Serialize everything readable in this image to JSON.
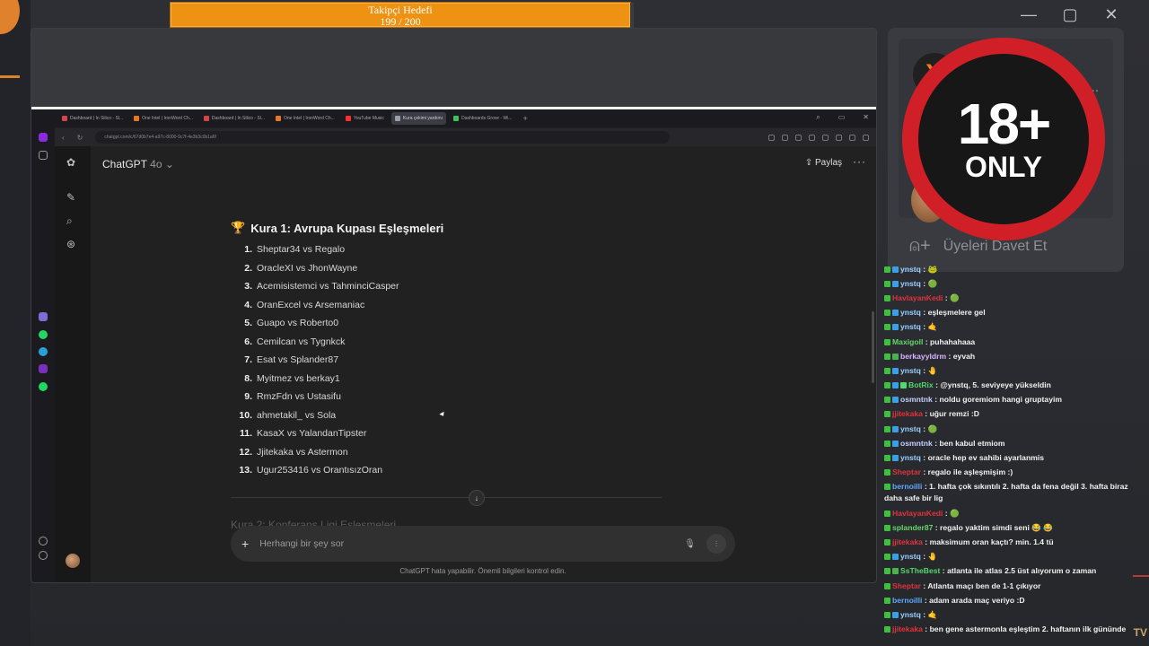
{
  "overlay": {
    "goal_title": "Takipçi Hedefi",
    "goal_progress": "199 / 200",
    "goal_fraction": 0.995,
    "window_controls": [
      "minimize-icon",
      "maximize-icon",
      "close-icon"
    ]
  },
  "browser": {
    "tabs": [
      {
        "label": "Dashboard | In Silico - Sl...",
        "color": "#d8434a"
      },
      {
        "label": "One Intel | IronWord Ch...",
        "color": "#e87722"
      },
      {
        "label": "Dashboard | In Silico - Sl...",
        "color": "#d8434a"
      },
      {
        "label": "One Intel | IronWord Ch...",
        "color": "#e87722"
      },
      {
        "label": "YouTube Music",
        "color": "#ff2e2e"
      },
      {
        "label": "Kura çekimi yardımı",
        "color": "#9aa0a6",
        "active": true
      },
      {
        "label": "Dashboards Grove - Wi...",
        "color": "#3ec15c"
      }
    ],
    "url": "chatgpt.com/c/67d0b7e4-a97c-8000-9c7f-4e3b3c0b1a6f"
  },
  "chatgpt": {
    "model": "ChatGPT",
    "version": "4o",
    "share_label": "Paylaş",
    "heading": "Kura 1: Avrupa Kupası Eşleşmeleri",
    "matches": [
      {
        "n": "1.",
        "text": "Sheptar34 vs Regalo"
      },
      {
        "n": "2.",
        "text": "OracleXI vs JhonWayne"
      },
      {
        "n": "3.",
        "text": "Acemisistemci vs TahminciCasper"
      },
      {
        "n": "4.",
        "text": "OranExcel vs Arsemaniac"
      },
      {
        "n": "5.",
        "text": "Guapo vs Roberto0"
      },
      {
        "n": "6.",
        "text": "Cemilcan vs Tygnkck"
      },
      {
        "n": "7.",
        "text": "Esat vs Splander87"
      },
      {
        "n": "8.",
        "text": "Myitmez vs berkay1"
      },
      {
        "n": "9.",
        "text": "RmzFdn vs Ustasifu"
      },
      {
        "n": "10.",
        "text": "ahmetakil_ vs Sola"
      },
      {
        "n": "11.",
        "text": "KasaX vs YalandanTipster"
      },
      {
        "n": "12.",
        "text": "Jjitekaka vs Astermon"
      },
      {
        "n": "13.",
        "text": "Ugur253416 vs OrantısızOran"
      }
    ],
    "next_heading": "Kura 2: Konferans Ligi Eşleşmeleri",
    "input_placeholder": "Herhangi bir şey sor",
    "disclaimer": "ChatGPT hata yapabilir. Önemli bilgileri kontrol edin."
  },
  "voice": {
    "name_partial": "O...",
    "badge_big": "18+",
    "badge_small": "ONLY",
    "invite_label": "Üyeleri Davet Et"
  },
  "chat": [
    {
      "user": "ynstq",
      "text": "🐸",
      "color": "#9ad0ff",
      "badges": [
        "#3fbf3f",
        "#39a0e8"
      ]
    },
    {
      "user": "ynstq",
      "text": "🟢",
      "color": "#9ad0ff",
      "badges": [
        "#3fbf3f",
        "#39a0e8"
      ]
    },
    {
      "user": "HavlayanKedi",
      "text": "🟢",
      "color": "#e0333a",
      "badges": [
        "#3fbf3f"
      ]
    },
    {
      "user": "ynstq",
      "text": "eşleşmelere gel",
      "color": "#9ad0ff",
      "badges": [
        "#3fbf3f",
        "#39a0e8"
      ]
    },
    {
      "user": "ynstq",
      "text": "🤙",
      "color": "#9ad0ff",
      "badges": [
        "#3fbf3f",
        "#39a0e8"
      ]
    },
    {
      "user": "Maxigoll",
      "text": "puhahahaaa",
      "color": "#66d66a",
      "badges": [
        "#3fbf3f"
      ]
    },
    {
      "user": "berkayyldrm",
      "text": "eyvah",
      "color": "#d9b3ff",
      "badges": [
        "#3fbf3f",
        "#4caf50"
      ]
    },
    {
      "user": "ynstq",
      "text": "🤚",
      "color": "#9ad0ff",
      "badges": [
        "#3fbf3f",
        "#39a0e8"
      ]
    },
    {
      "user": "BotRix",
      "text": "@ynstq, 5. seviyeye yükseldin",
      "color": "#53d96b",
      "badges": [
        "#3fbf3f",
        "#39a0e8",
        "#53d96b"
      ]
    },
    {
      "user": "osmntnk",
      "text": "noldu goremiom hangi gruptayim",
      "color": "#c6d0ff",
      "badges": [
        "#3fbf3f",
        "#39a0e8"
      ]
    },
    {
      "user": "jjitekaka",
      "text": "uğur remzi :D",
      "color": "#e0333a",
      "badges": [
        "#3fbf3f"
      ]
    },
    {
      "user": "ynstq",
      "text": "🟢",
      "color": "#9ad0ff",
      "badges": [
        "#3fbf3f",
        "#39a0e8"
      ]
    },
    {
      "user": "osmntnk",
      "text": "ben kabul etmiom",
      "color": "#c6d0ff",
      "badges": [
        "#3fbf3f",
        "#39a0e8"
      ]
    },
    {
      "user": "ynstq",
      "text": "oracle hep ev sahibi ayarlanmis",
      "color": "#9ad0ff",
      "badges": [
        "#3fbf3f",
        "#39a0e8"
      ]
    },
    {
      "user": "Sheptar",
      "text": "regalo ile aşleşmişim :)",
      "color": "#e0333a",
      "badges": [
        "#3fbf3f"
      ]
    },
    {
      "user": "bernoilli",
      "text": "1. hafta çok sıkıntılı 2. hafta da fena değil 3. hafta biraz daha safe bir lig",
      "color": "#5fa8ff",
      "badges": [
        "#3fbf3f"
      ]
    },
    {
      "user": "HavlayanKedi",
      "text": "🟢",
      "color": "#e0333a",
      "badges": [
        "#3fbf3f"
      ]
    },
    {
      "user": "splander87",
      "text": "regalo yaktim simdi seni 😂 😂",
      "color": "#66d66a",
      "badges": [
        "#3fbf3f"
      ]
    },
    {
      "user": "jjitekaka",
      "text": "maksimum oran kaçtı? min. 1.4 tü",
      "color": "#e0333a",
      "badges": [
        "#3fbf3f"
      ]
    },
    {
      "user": "ynstq",
      "text": "🤚",
      "color": "#9ad0ff",
      "badges": [
        "#3fbf3f",
        "#39a0e8"
      ]
    },
    {
      "user": "SsTheBest",
      "text": "atlanta ile atlas 2.5 üst alıyorum o zaman",
      "color": "#53d96b",
      "badges": [
        "#3fbf3f",
        "#4caf50"
      ]
    },
    {
      "user": "Sheptar",
      "text": "Atlanta maçı ben de 1-1 çıkıyor",
      "color": "#e0333a",
      "badges": [
        "#3fbf3f"
      ]
    },
    {
      "user": "bernoilli",
      "text": "adam arada maç veriyo :D",
      "color": "#5fa8ff",
      "badges": [
        "#3fbf3f"
      ]
    },
    {
      "user": "ynstq",
      "text": "🤙",
      "color": "#9ad0ff",
      "badges": [
        "#3fbf3f",
        "#39a0e8"
      ]
    },
    {
      "user": "jjitekaka",
      "text": "ben gene astermonla eşleştim 2. haftanın ilk gününde",
      "color": "#e0333a",
      "badges": [
        "#3fbf3f"
      ]
    }
  ]
}
